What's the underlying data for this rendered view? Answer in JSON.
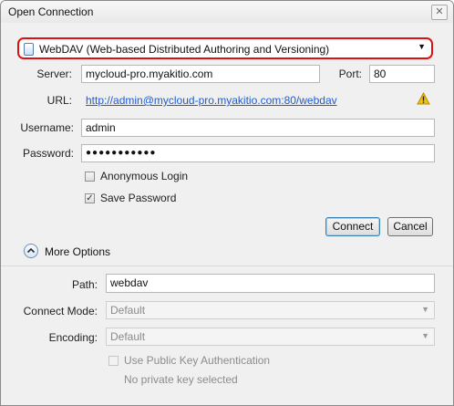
{
  "window": {
    "title": "Open Connection",
    "close_glyph": "✕"
  },
  "protocol": {
    "selected": "WebDAV (Web-based Distributed Authoring and Versioning)",
    "icon": "webdav-drive-icon",
    "highlight_color": "#e01010"
  },
  "server": {
    "label": "Server:",
    "value": "mycloud-pro.myakitio.com"
  },
  "port": {
    "label": "Port:",
    "value": "80"
  },
  "url": {
    "label": "URL:",
    "value": "http://admin@mycloud-pro.myakitio.com:80/webdav",
    "warning_icon": "warning-icon"
  },
  "username": {
    "label": "Username:",
    "value": "admin"
  },
  "password": {
    "label": "Password:",
    "value": "●●●●●●●●●●●"
  },
  "anonymous_login": {
    "label": "Anonymous Login",
    "checked": false
  },
  "save_password": {
    "label": "Save Password",
    "checked": true,
    "glyph": "✓"
  },
  "buttons": {
    "connect": "Connect",
    "cancel": "Cancel"
  },
  "more_options": {
    "label": "More Options",
    "expanded": true
  },
  "path": {
    "label": "Path:",
    "value": "webdav"
  },
  "connect_mode": {
    "label": "Connect Mode:",
    "value": "Default"
  },
  "encoding": {
    "label": "Encoding:",
    "value": "Default"
  },
  "public_key_auth": {
    "label": "Use Public Key Authentication",
    "checked": false,
    "disabled": true
  },
  "private_key_status": "No private key selected"
}
